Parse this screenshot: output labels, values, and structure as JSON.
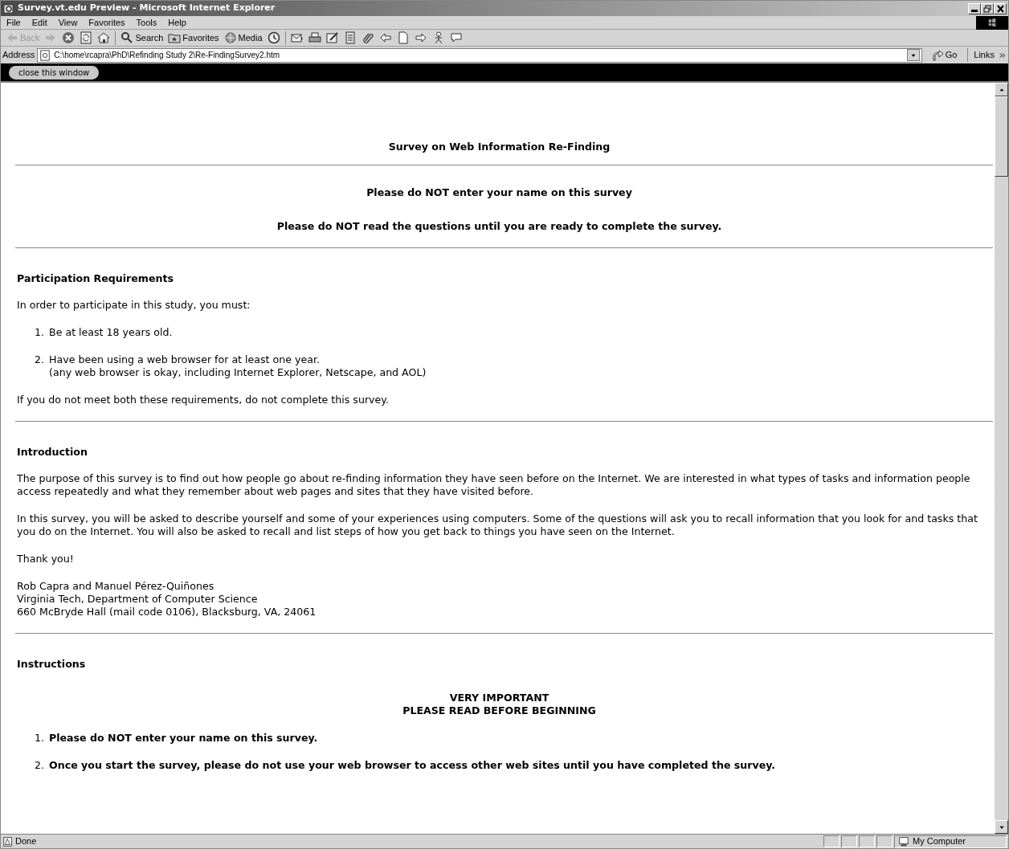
{
  "window": {
    "title": "Survey.vt.edu Preview - Microsoft Internet Explorer"
  },
  "menu": [
    "File",
    "Edit",
    "View",
    "Favorites",
    "Tools",
    "Help"
  ],
  "toolbar": [
    {
      "kind": "back",
      "label": "Back",
      "disabled": true
    },
    {
      "kind": "forward",
      "disabled": true
    },
    {
      "kind": "stop",
      "disabled": false
    },
    {
      "kind": "refresh",
      "disabled": false
    },
    {
      "kind": "home",
      "disabled": false
    },
    {
      "kind": "search",
      "label": "Search",
      "disabled": false
    },
    {
      "kind": "favorites",
      "label": "Favorites",
      "disabled": false
    },
    {
      "kind": "media",
      "label": "Media",
      "disabled": false
    },
    {
      "kind": "history",
      "disabled": false
    },
    {
      "kind": "mail",
      "disabled": false
    },
    {
      "kind": "print",
      "disabled": false
    },
    {
      "kind": "edit",
      "disabled": false
    },
    {
      "kind": "discuss",
      "disabled": false
    },
    {
      "kind": "clip",
      "disabled": false
    },
    {
      "kind": "prev",
      "disabled": false
    },
    {
      "kind": "page",
      "disabled": false
    },
    {
      "kind": "next",
      "disabled": false
    },
    {
      "kind": "person",
      "disabled": false
    },
    {
      "kind": "bubble",
      "disabled": false
    }
  ],
  "address_bar": {
    "label": "Address",
    "value": "C:\\home\\rcapra\\PhD\\Refinding Study 2\\Re-FindingSurvey2.htm",
    "go": "Go",
    "links": "Links"
  },
  "preview_bar": {
    "button": "close this window"
  },
  "document": [
    {
      "kind": "title",
      "lines": [
        "Survey on Web Information Re-Finding"
      ]
    },
    {
      "kind": "rule"
    },
    {
      "kind": "notice",
      "lines": [
        "Please do NOT enter your name on this survey"
      ]
    },
    {
      "kind": "notice",
      "lines": [
        "Please do NOT read the questions until you are ready to complete the survey."
      ]
    },
    {
      "kind": "rule"
    },
    {
      "kind": "heading",
      "lines": [
        "Participation Requirements"
      ]
    },
    {
      "kind": "paragraph",
      "lines": [
        "In order to participate in this study, you must:"
      ]
    },
    {
      "kind": "list",
      "bold": false,
      "items": [
        {
          "number": "1.",
          "lines": [
            "Be at least 18 years old."
          ]
        },
        {
          "number": "2.",
          "lines": [
            "Have been using a web browser for at least one year.",
            "(any web browser is okay, including Internet Explorer, Netscape, and AOL)"
          ]
        }
      ]
    },
    {
      "kind": "paragraph",
      "lines": [
        "If you do not meet both these requirements, do not complete this survey."
      ]
    },
    {
      "kind": "rule"
    },
    {
      "kind": "heading",
      "lines": [
        "Introduction"
      ]
    },
    {
      "kind": "paragraph",
      "lines": [
        "The purpose of this survey is to find out how people go about re-finding information they have seen before on the Internet. We are interested in what types of tasks and information people access repeatedly and what they remember about web pages and sites that they have visited before."
      ]
    },
    {
      "kind": "paragraph",
      "lines": [
        "In this survey, you will be asked to describe yourself and some of your experiences using computers. Some of the questions will ask you to recall information that you look for and tasks that you do on the Internet. You will also be asked to recall and list steps of how you get back to things you have seen on the Internet."
      ]
    },
    {
      "kind": "paragraph",
      "lines": [
        "Thank you!"
      ]
    },
    {
      "kind": "paragraph",
      "lines": [
        "Rob Capra and Manuel Pérez-Quiñones",
        "Virginia Tech, Department of Computer Science",
        "660 McBryde Hall (mail code 0106), Blacksburg, VA, 24061"
      ]
    },
    {
      "kind": "rule"
    },
    {
      "kind": "heading",
      "lines": [
        "Instructions"
      ]
    },
    {
      "kind": "notice",
      "lines": [
        "VERY IMPORTANT",
        "PLEASE READ BEFORE BEGINNING"
      ]
    },
    {
      "kind": "list",
      "bold": true,
      "items": [
        {
          "number": "1.",
          "lines": [
            "Please do NOT enter your name on this survey."
          ]
        },
        {
          "number": "2.",
          "lines": [
            "Once you start the survey, please do not use your web browser to access other web sites until you have completed the survey."
          ]
        }
      ]
    }
  ],
  "status_bar": {
    "text": "Done",
    "zone": "My Computer"
  }
}
